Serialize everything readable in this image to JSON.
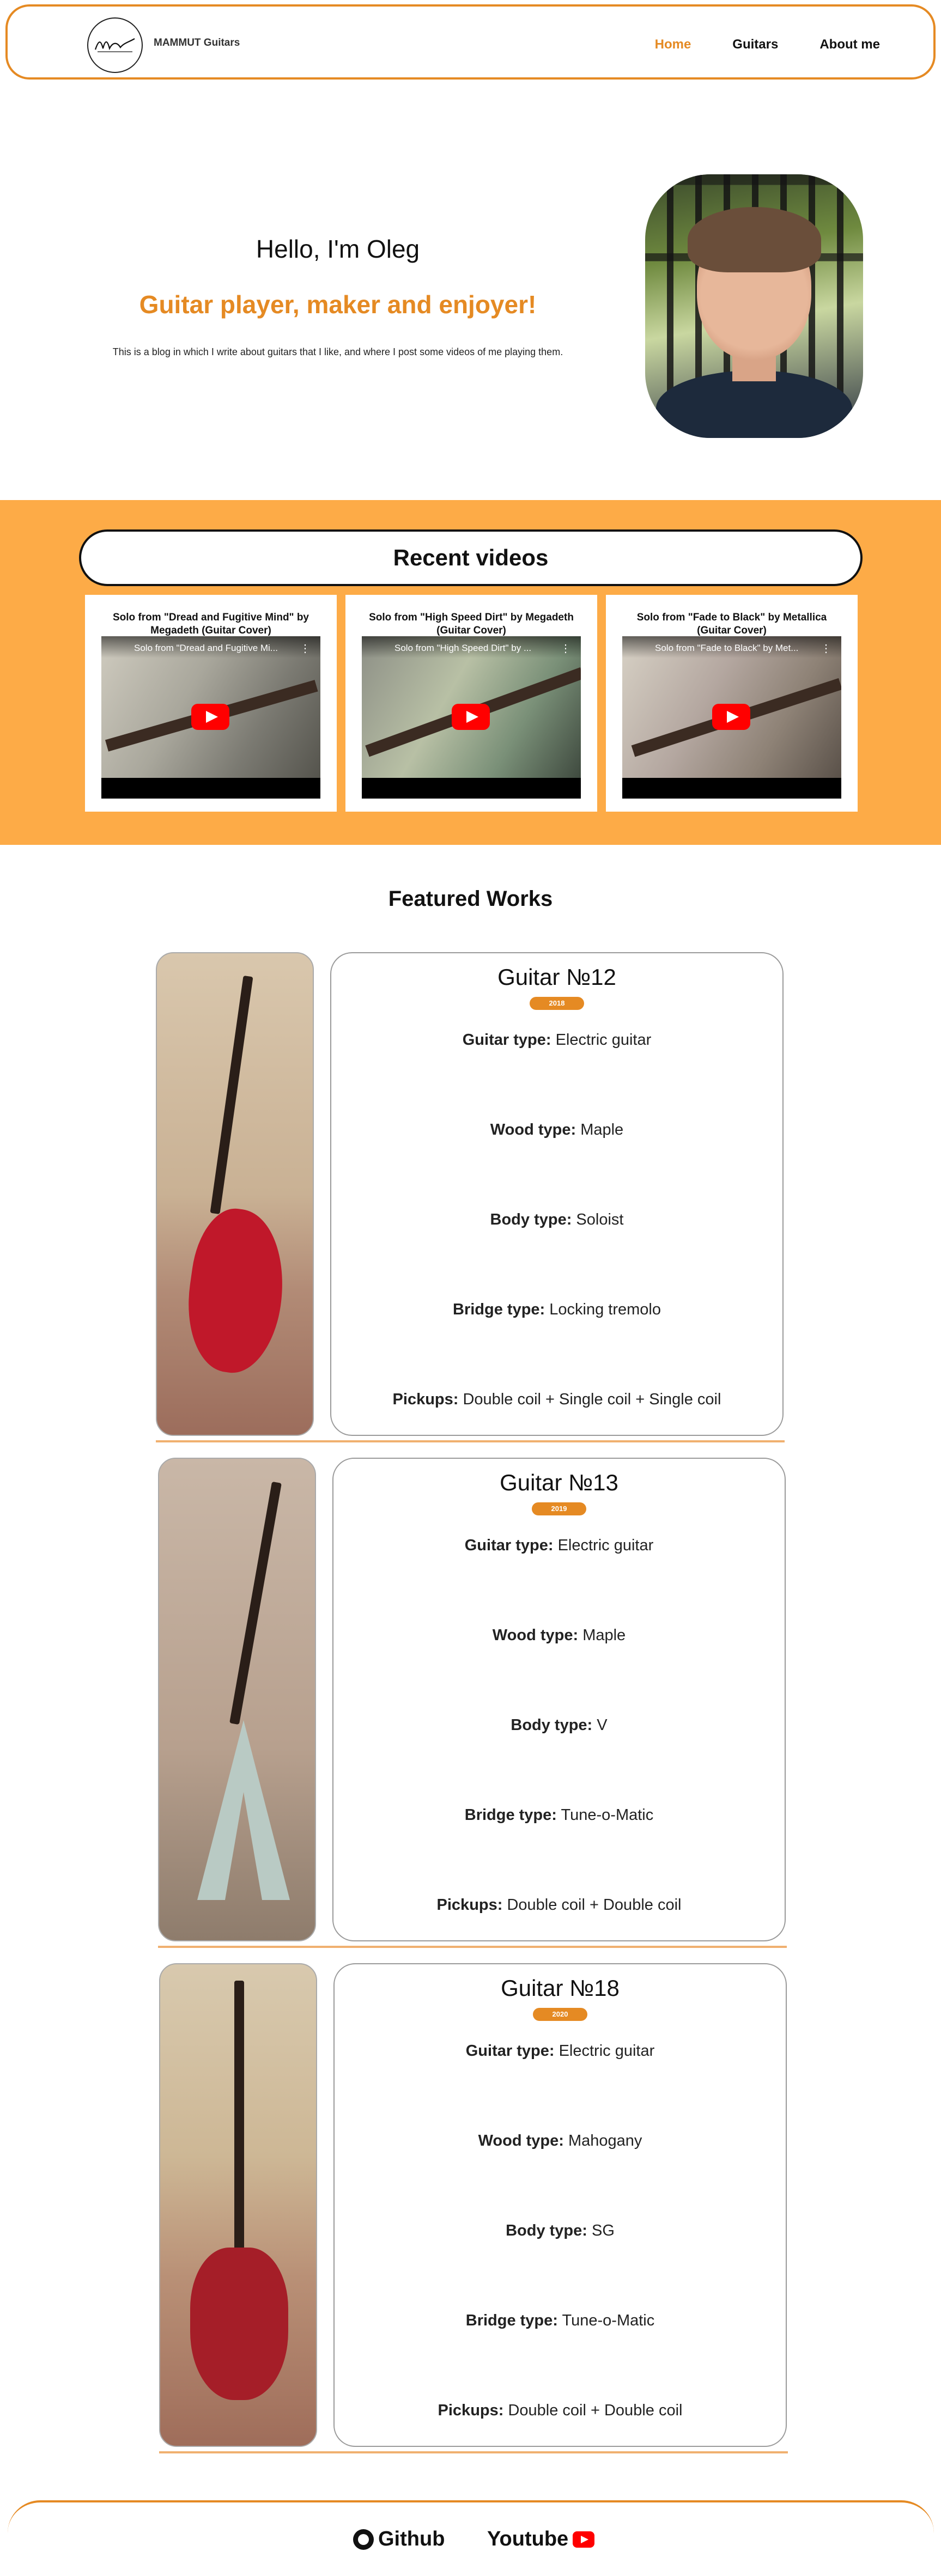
{
  "header": {
    "brand": "MAMMUT Guitars",
    "logo_icon": "mammut-logo",
    "nav": [
      {
        "label": "Home",
        "active": true
      },
      {
        "label": "Guitars",
        "active": false
      },
      {
        "label": "About me",
        "active": false
      }
    ],
    "accent_color": "#e58a23"
  },
  "hero": {
    "title": "Hello, I'm Oleg",
    "subtitle": "Guitar player, maker and enjoyer!",
    "description": "This is a blog in which I write about guitars that I like, and where I post some videos of me playing them."
  },
  "videos": {
    "heading": "Recent videos",
    "band_color": "#fdab47",
    "items": [
      {
        "title": "Solo from \"Dread and Fugitive Mind\" by Megadeth (Guitar Cover)",
        "overlay": "Solo from \"Dread and Fugitive Mi..."
      },
      {
        "title": "Solo from \"High Speed Dirt\" by Megadeth (Guitar Cover)",
        "overlay": "Solo from \"High Speed Dirt\" by ..."
      },
      {
        "title": "Solo from \"Fade to Black\" by Metallica (Guitar Cover)",
        "overlay": "Solo from \"Fade to Black\" by Met..."
      }
    ]
  },
  "featured": {
    "heading": "Featured Works",
    "works": [
      {
        "name": "Guitar №12",
        "year": "2018",
        "specs": [
          {
            "label": "Guitar type:",
            "value": "Electric guitar"
          },
          {
            "label": "Wood type:",
            "value": "Maple"
          },
          {
            "label": "Body type:",
            "value": "Soloist"
          },
          {
            "label": "Bridge type:",
            "value": "Locking tremolo"
          },
          {
            "label": "Pickups:",
            "value": "Double coil + Single coil + Single coil"
          }
        ]
      },
      {
        "name": "Guitar №13",
        "year": "2019",
        "specs": [
          {
            "label": "Guitar type:",
            "value": "Electric guitar"
          },
          {
            "label": "Wood type:",
            "value": "Maple"
          },
          {
            "label": "Body type:",
            "value": "V"
          },
          {
            "label": "Bridge type:",
            "value": "Tune-o-Matic"
          },
          {
            "label": "Pickups:",
            "value": "Double coil + Double coil"
          }
        ]
      },
      {
        "name": "Guitar №18",
        "year": "2020",
        "specs": [
          {
            "label": "Guitar type:",
            "value": "Electric guitar"
          },
          {
            "label": "Wood type:",
            "value": "Mahogany"
          },
          {
            "label": "Body type:",
            "value": "SG"
          },
          {
            "label": "Bridge type:",
            "value": "Tune-o-Matic"
          },
          {
            "label": "Pickups:",
            "value": "Double coil + Double coil"
          }
        ]
      }
    ]
  },
  "footer": {
    "links": [
      {
        "label": "Github",
        "icon": "github-icon"
      },
      {
        "label": "Youtube",
        "icon": "youtube-icon"
      }
    ]
  }
}
